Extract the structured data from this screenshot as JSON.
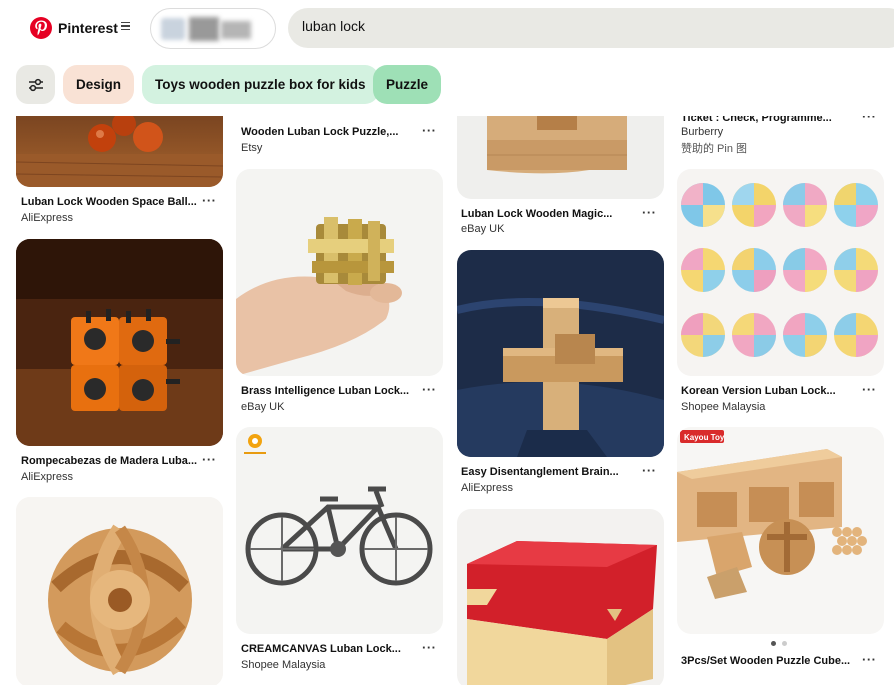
{
  "header": {
    "brand": "Pinterest",
    "search_value": "luban lock"
  },
  "filters": {
    "chips": [
      "Design",
      "Toys wooden puzzle box for kids",
      "Puzzle"
    ]
  },
  "pins": {
    "c1p1": {
      "title": "Luban Lock Wooden Space Ball...",
      "source": "AliExpress"
    },
    "c1p2": {
      "title": "Rompecabezas de Madera Luba...",
      "source": "AliExpress"
    },
    "c2p1": {
      "title": "Wooden Luban Lock Puzzle,...",
      "source": "Etsy"
    },
    "c2p2": {
      "title": "Brass Intelligence Luban Lock...",
      "source": "eBay UK"
    },
    "c2p3": {
      "title": "CREAMCANVAS Luban Lock...",
      "source": "Shopee Malaysia"
    },
    "c3p1": {
      "title": "Luban Lock Wooden Magic...",
      "source": "eBay UK"
    },
    "c3p2": {
      "title": "Easy Disentanglement Brain...",
      "source": "AliExpress"
    },
    "c4p1": {
      "title": "Ticket : Check, Programme...",
      "source": "Burberry",
      "sponsored": "赞助的 Pin 图"
    },
    "c4p2": {
      "title": "Korean Version Luban Lock...",
      "source": "Shopee Malaysia"
    },
    "c4p3": {
      "title": "3Pcs/Set Wooden Puzzle Cube...",
      "badge": "Kayou Toy"
    }
  },
  "more_label": "···",
  "colors": {
    "brand_red": "#e60023",
    "chip_design": "#f9e2d5",
    "chip_toys": "#d3f2e0",
    "chip_puzzle": "#9ee0b6",
    "search_bg": "#e9e9e4"
  }
}
